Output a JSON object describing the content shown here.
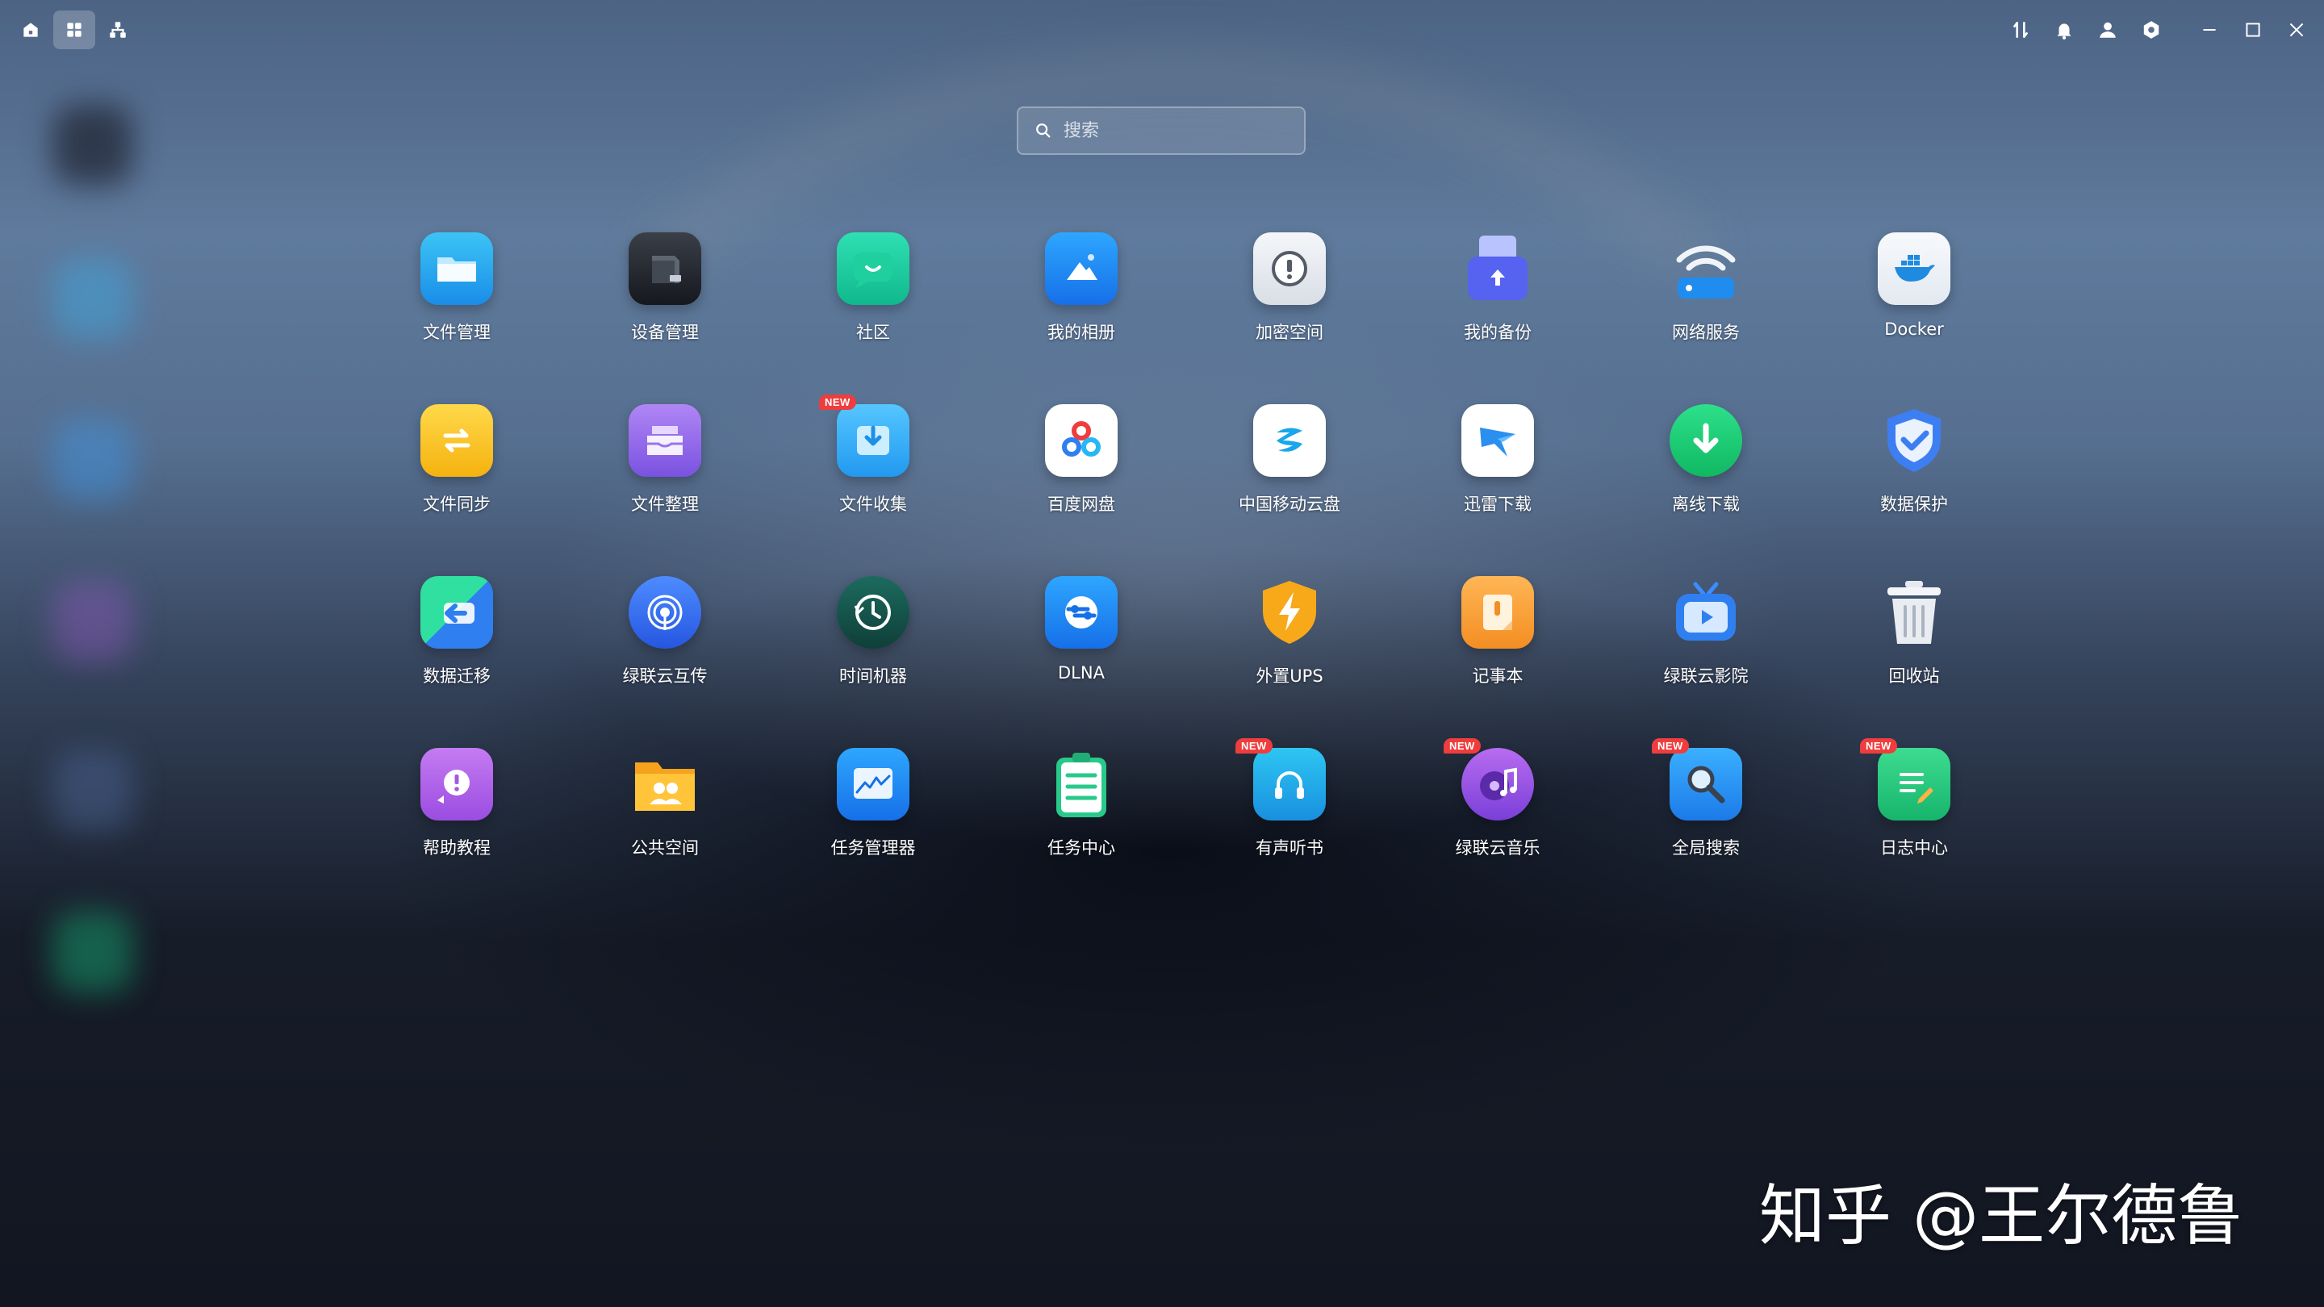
{
  "search": {
    "placeholder": "搜索"
  },
  "apps": [
    {
      "label": "文件管理"
    },
    {
      "label": "设备管理"
    },
    {
      "label": "社区"
    },
    {
      "label": "我的相册"
    },
    {
      "label": "加密空间"
    },
    {
      "label": "我的备份"
    },
    {
      "label": "网络服务"
    },
    {
      "label": "Docker"
    },
    {
      "label": "文件同步"
    },
    {
      "label": "文件整理"
    },
    {
      "label": "文件收集",
      "badge": "NEW"
    },
    {
      "label": "百度网盘"
    },
    {
      "label": "中国移动云盘"
    },
    {
      "label": "迅雷下载"
    },
    {
      "label": "离线下载"
    },
    {
      "label": "数据保护"
    },
    {
      "label": "数据迁移"
    },
    {
      "label": "绿联云互传"
    },
    {
      "label": "时间机器"
    },
    {
      "label": "DLNA"
    },
    {
      "label": "外置UPS"
    },
    {
      "label": "记事本"
    },
    {
      "label": "绿联云影院"
    },
    {
      "label": "回收站"
    },
    {
      "label": "帮助教程"
    },
    {
      "label": "公共空间"
    },
    {
      "label": "任务管理器"
    },
    {
      "label": "任务中心"
    },
    {
      "label": "有声听书",
      "badge": "NEW"
    },
    {
      "label": "绿联云音乐",
      "badge": "NEW"
    },
    {
      "label": "全局搜索",
      "badge": "NEW"
    },
    {
      "label": "日志中心",
      "badge": "NEW"
    }
  ],
  "watermark": "知乎 @王尔德鲁"
}
